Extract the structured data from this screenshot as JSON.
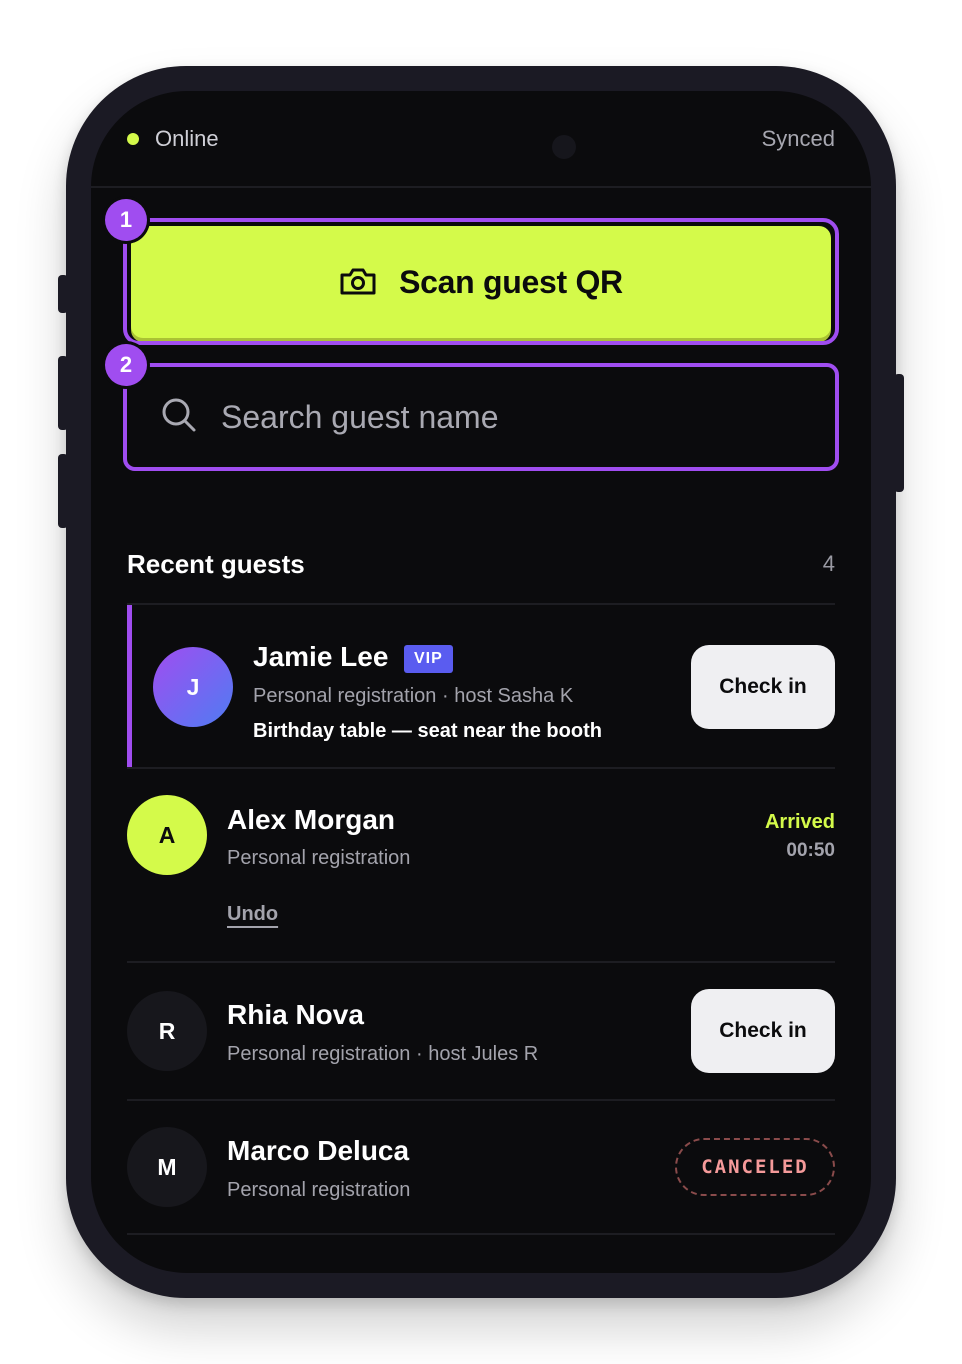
{
  "status": {
    "connection": "Online",
    "sync": "Synced"
  },
  "steps": [
    "1",
    "2"
  ],
  "scan": {
    "label": "Scan guest QR",
    "icon": "camera-icon"
  },
  "search": {
    "placeholder": "Search guest name",
    "icon": "search-icon"
  },
  "recent": {
    "title": "Recent guests",
    "count": "4",
    "guests": [
      {
        "initial": "J",
        "name": "Jamie Lee",
        "badge": "VIP",
        "sub": "Personal registration · host Sasha K",
        "note": "Birthday table — seat near the booth",
        "action": "Check in"
      },
      {
        "initial": "A",
        "name": "Alex Morgan",
        "sub": "Personal registration",
        "status": "Arrived",
        "time": "00:50",
        "undo": "Undo"
      },
      {
        "initial": "R",
        "name": "Rhia Nova",
        "sub": "Personal registration · host Jules R",
        "action": "Check in"
      },
      {
        "initial": "M",
        "name": "Marco Deluca",
        "sub": "Personal registration",
        "status": "CANCELED"
      }
    ]
  },
  "colors": {
    "accent": "#d4fa4a",
    "highlight": "#a04df0",
    "vip": "#5a5cf0",
    "canceled": "#f59a9a",
    "background": "#0b0b0d"
  }
}
